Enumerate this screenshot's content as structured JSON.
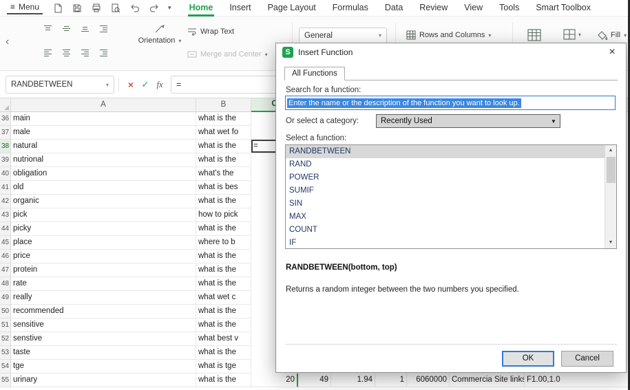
{
  "colors": {
    "accent": "#1ea34c",
    "blue": "#2b7cd3",
    "blue_sel": "#3b87e0",
    "navy": "#1f3864"
  },
  "icons": {
    "hamburger": "≡",
    "chevron_down": "▾",
    "chevron_left": "‹",
    "close": "×",
    "cancel": "×",
    "check": "✓",
    "fx": "fx",
    "scroll_up": "▲",
    "scroll_down": "▼",
    "dropdown": "▼"
  },
  "app": {
    "menu_label": "Menu",
    "tabs": [
      "Home",
      "Insert",
      "Page Layout",
      "Formulas",
      "Data",
      "Review",
      "View",
      "Tools",
      "Smart Toolbox"
    ],
    "active_tab": "Home"
  },
  "toolbar": {
    "orientation": "Orientation",
    "wrap_text": "Wrap Text",
    "merge_center": "Merge and Center",
    "number_format": "General",
    "rows_columns": "Rows and Columns",
    "fill": "Fill"
  },
  "formula_bar": {
    "name_box": "RANDBETWEEN",
    "formula": "="
  },
  "grid": {
    "columns": [
      "A",
      "B",
      "C"
    ],
    "rows": [
      {
        "num": 36,
        "a": "main",
        "b": "what is the"
      },
      {
        "num": 37,
        "a": "male",
        "b": "what wet fo"
      },
      {
        "num": 38,
        "a": "natural",
        "b": "what is the",
        "c": "=",
        "active": true
      },
      {
        "num": 39,
        "a": "nutrional",
        "b": "what is the"
      },
      {
        "num": 40,
        "a": "obligation",
        "b": "what's the"
      },
      {
        "num": 41,
        "a": "old",
        "b": "what is bes"
      },
      {
        "num": 42,
        "a": "organic",
        "b": "what is the"
      },
      {
        "num": 43,
        "a": "pick",
        "b": "how to pick"
      },
      {
        "num": 44,
        "a": "picky",
        "b": "what is the"
      },
      {
        "num": 45,
        "a": "place",
        "b": "where to b"
      },
      {
        "num": 46,
        "a": "price",
        "b": "what is the"
      },
      {
        "num": 47,
        "a": "protein",
        "b": "what is the"
      },
      {
        "num": 48,
        "a": "rate",
        "b": "what is the"
      },
      {
        "num": 49,
        "a": "really",
        "b": "what wet c"
      },
      {
        "num": 50,
        "a": "recommended",
        "b": "what is the"
      },
      {
        "num": 51,
        "a": "sensitive",
        "b": "what is the"
      },
      {
        "num": 52,
        "a": "senstive",
        "b": "what best v"
      },
      {
        "num": 53,
        "a": "taste",
        "b": "what is the"
      },
      {
        "num": 54,
        "a": "tge",
        "b": "what is tge"
      },
      {
        "num": 55,
        "a": "urinary",
        "b": "what is the",
        "extra": [
          {
            "v": "20",
            "a": "r"
          },
          {
            "v": "49",
            "a": "r"
          },
          {
            "v": "1.94",
            "a": "r"
          },
          {
            "v": "1",
            "a": "r"
          },
          {
            "v": "6060000",
            "a": "r"
          },
          {
            "v": "Commercia Site links,",
            "a": "l"
          },
          {
            "v": "F1.00,1.0",
            "a": "l"
          }
        ]
      }
    ]
  },
  "dialog": {
    "title": "Insert Function",
    "tab": "All Functions",
    "search_label": "Search for a function:",
    "search_value": "Enter the name or the description of the function you want to look up.",
    "category_label": "Or select a category:",
    "category_value": "Recently Used",
    "select_label": "Select a function:",
    "functions": [
      "RANDBETWEEN",
      "RAND",
      "POWER",
      "SUMIF",
      "SIN",
      "MAX",
      "COUNT",
      "IF"
    ],
    "selected_function": "RANDBETWEEN",
    "signature": "RANDBETWEEN(bottom, top)",
    "description": "Returns a random integer between the two numbers you specified.",
    "ok_label": "OK",
    "cancel_label": "Cancel"
  }
}
